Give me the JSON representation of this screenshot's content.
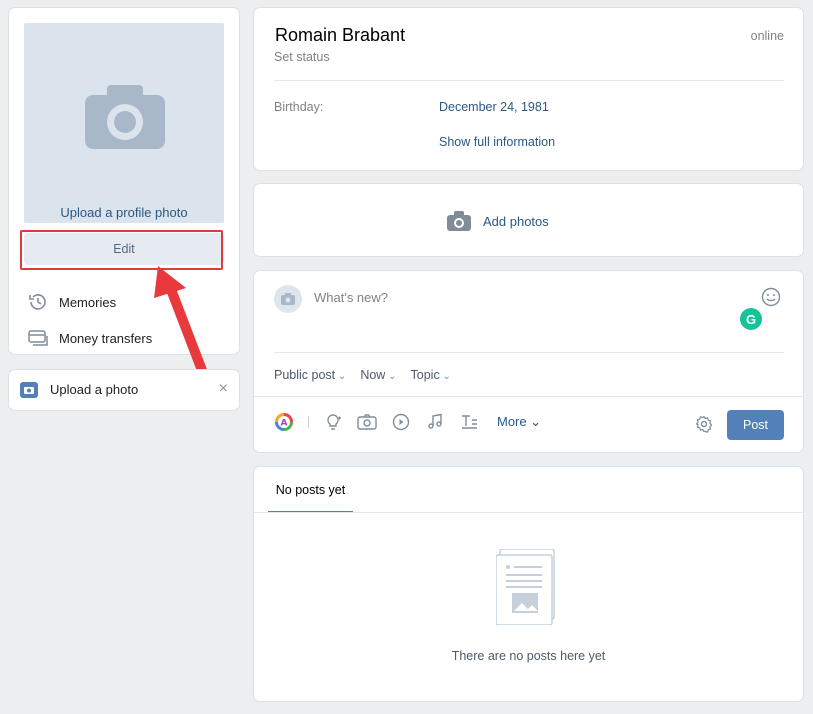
{
  "left": {
    "upload_profile_photo": "Upload a profile photo",
    "edit_label": "Edit",
    "menu": [
      {
        "label": "Memories",
        "icon": "history-icon"
      },
      {
        "label": "Money transfers",
        "icon": "card-icon"
      }
    ]
  },
  "upload_card": {
    "label": "Upload a photo",
    "close": "×"
  },
  "profile": {
    "name": "Romain Brabant",
    "set_status": "Set status",
    "online": "online",
    "birthday_label": "Birthday:",
    "birthday_value": "December 24, 1981",
    "show_full": "Show full information"
  },
  "photos": {
    "add_photos": "Add photos"
  },
  "composer": {
    "placeholder": "What's new?",
    "grammarly": "G",
    "options": [
      "Public post",
      "Now",
      "Topic"
    ],
    "more": "More ⌄",
    "post_button": "Post"
  },
  "feed": {
    "tab": "No posts yet",
    "empty_text": "There are no posts here yet"
  },
  "colors": {
    "accent": "#5181b8",
    "link": "#2a5885",
    "highlight": "#e03b3b"
  }
}
